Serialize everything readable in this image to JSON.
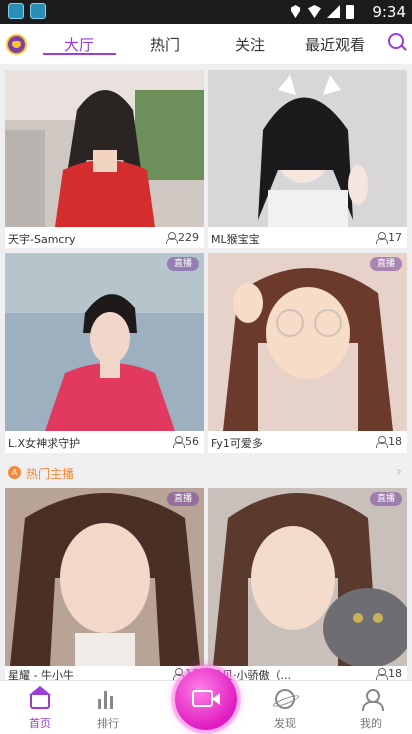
{
  "status_bar": {
    "time": "9:34"
  },
  "top_nav": {
    "tabs": [
      {
        "label": "大厅",
        "active": true
      },
      {
        "label": "热门",
        "active": false
      },
      {
        "label": "关注",
        "active": false
      },
      {
        "label": "最近观看",
        "active": false
      }
    ]
  },
  "streams": [
    {
      "name": "天宇-Samcry",
      "viewers": "229",
      "live_badge": ""
    },
    {
      "name": "ML猴宝宝",
      "viewers": "17",
      "live_badge": ""
    },
    {
      "name": "L.X女神求守护",
      "viewers": "56",
      "live_badge": "直播"
    },
    {
      "name": "Fy1可爱多",
      "viewers": "18",
      "live_badge": "直播"
    }
  ],
  "hot_section": {
    "title": "热门主播",
    "icon_text": "A",
    "items": [
      {
        "name": "星耀 - 牛小牛",
        "viewers": "17",
        "live_badge": "直播"
      },
      {
        "name": "贝贝·小骄傲（...",
        "viewers": "18",
        "live_badge": "直播"
      }
    ]
  },
  "bottom_nav": {
    "items": [
      {
        "label": "首页",
        "icon": "home-icon",
        "active": true
      },
      {
        "label": "排行",
        "icon": "ranking-icon",
        "active": false
      },
      {
        "label": "发现",
        "icon": "discover-icon",
        "active": false
      },
      {
        "label": "我的",
        "icon": "profile-icon",
        "active": false
      }
    ],
    "center": {
      "icon": "video-camera-icon"
    }
  },
  "colors": {
    "accent": "#9b3bd8",
    "hot": "#f5893a",
    "live_button": "#e01cc0"
  }
}
